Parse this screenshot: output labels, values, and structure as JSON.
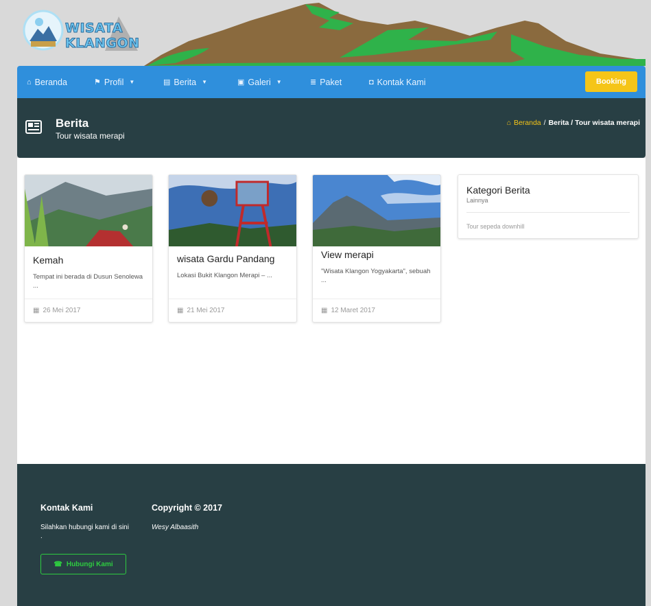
{
  "logo": {
    "line1": "WISATA",
    "line2": "KLANGON"
  },
  "nav": {
    "items": [
      {
        "label": "Beranda",
        "icon": "home-icon"
      },
      {
        "label": "Profil",
        "icon": "flag-icon"
      },
      {
        "label": "Berita",
        "icon": "newspaper-icon"
      },
      {
        "label": "Galeri",
        "icon": "image-icon"
      },
      {
        "label": "Paket",
        "icon": "list-icon"
      },
      {
        "label": "Kontak Kami",
        "icon": "chat-icon"
      }
    ],
    "booking": "Booking"
  },
  "titlebar": {
    "title": "Berita",
    "subtitle": "Tour wisata merapi",
    "breadcrumb": {
      "home": "Beranda",
      "sep": "/",
      "current": "Berita / Tour wisata merapi"
    }
  },
  "cards": [
    {
      "title": "Kemah",
      "desc": "Tempat ini berada di Dusun Senolewa ...",
      "date": "26 Mei 2017"
    },
    {
      "title": "wisata Gardu Pandang",
      "desc": "Lokasi Bukit Klangon Merapi – ...",
      "date": "21 Mei 2017"
    },
    {
      "title": "View merapi",
      "desc": "\"Wisata Klangon Yogyakarta\", sebuah ...",
      "date": "12 Maret 2017"
    }
  ],
  "kategori": {
    "title": "Kategori Berita",
    "subtitle": "Lainnya",
    "item": "Tour sepeda downhill"
  },
  "footer": {
    "kontak_title": "Kontak Kami",
    "kontak_text": "Silahkan hubungi kami di sini .",
    "button": "Hubungi Kami",
    "copyright_title": "Copyright © 2017",
    "author": "Wesy Albaasith"
  },
  "colors": {
    "navbar": "#2f8fdc",
    "dark": "#283f44",
    "booking": "#f5c518",
    "green": "#2ecc40"
  }
}
